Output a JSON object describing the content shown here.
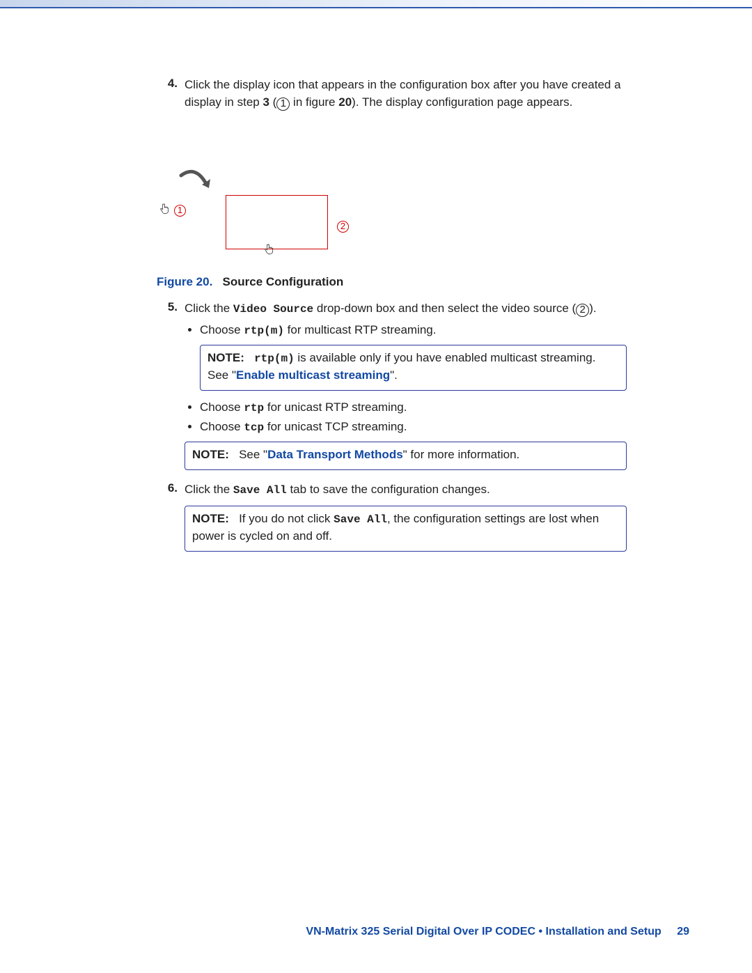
{
  "steps": {
    "s4": {
      "num": "4.",
      "text_before": "Click the display icon that appears in the configuration box after you have created a display in step ",
      "bold_step": "3",
      "paren_open": " (",
      "circled_1": "1",
      "mid": " in figure ",
      "bold_fig": "20",
      "text_after": "). The display configuration page appears."
    },
    "s5": {
      "num": "5.",
      "text_before": "Click the ",
      "code_1": "Video Source",
      "mid": " drop-down box and then select the video source (",
      "circled_2": "2",
      "after": ").",
      "bullets": {
        "b1_before": "Choose ",
        "b1_code": "rtp(m)",
        "b1_after": " for multicast RTP streaming.",
        "b2_before": "Choose ",
        "b2_code": "rtp",
        "b2_after": " for unicast RTP streaming.",
        "b3_before": "Choose ",
        "b3_code": "tcp",
        "b3_after": " for unicast TCP streaming."
      }
    },
    "s6": {
      "num": "6.",
      "text_before": "Click the ",
      "code": "Save All",
      "text_after": " tab to save the configuration changes."
    }
  },
  "figure": {
    "label": "Figure 20.",
    "title": "Source Configuration",
    "callout_1": "1",
    "callout_2": "2"
  },
  "notes": {
    "note_label": "NOTE:",
    "n1_code": "rtp(m)",
    "n1_before": " is available only if you have enabled multicast streaming. See \"",
    "n1_link": "Enable multicast streaming",
    "n1_after": "\".",
    "n2_before": "See \"",
    "n2_link": "Data Transport Methods",
    "n2_after": "\" for more information.",
    "n3_before": "If you do not click ",
    "n3_code": "Save All",
    "n3_after": ", the configuration settings are lost when power is cycled on and off."
  },
  "footer": {
    "title": "VN-Matrix 325 Serial Digital Over IP CODEC • Installation and Setup",
    "page": "29"
  }
}
